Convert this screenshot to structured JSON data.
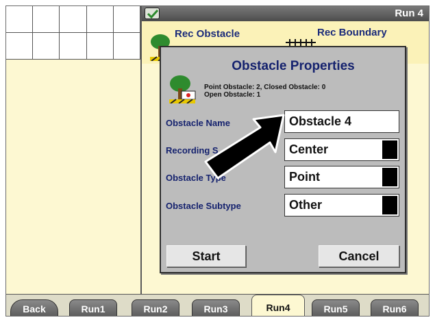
{
  "header": {
    "run_title": "Run 4"
  },
  "rec_row": {
    "obstacle_label": "Rec Obstacle",
    "boundary_label": "Rec Boundary"
  },
  "dialog": {
    "title": "Obstacle Properties",
    "counts_line1": "Point Obstacle: 2, Closed Obstacle: 0",
    "counts_line2": "Open Obstacle: 1",
    "fields": [
      {
        "label": "Obstacle Name",
        "value": "Obstacle 4"
      },
      {
        "label": "Recording S",
        "value": "Center"
      },
      {
        "label": "Obstacle Type",
        "value": "Point"
      },
      {
        "label": "Obstacle Subtype",
        "value": "Other"
      }
    ],
    "start_label": "Start",
    "cancel_label": "Cancel"
  },
  "tabs": [
    "Back",
    "Run1",
    "Run2",
    "Run3",
    "Run4",
    "Run5",
    "Run6"
  ],
  "active_tab": "Run4",
  "icons": [
    "check-icon",
    "tree-icon",
    "fence-icon",
    "dropdown-arrow-icon",
    "pointer-arrow-icon"
  ],
  "colors": {
    "panel": "#fdf8d2",
    "label_text": "#15226e",
    "dialog_bg": "#bcbcbc"
  }
}
